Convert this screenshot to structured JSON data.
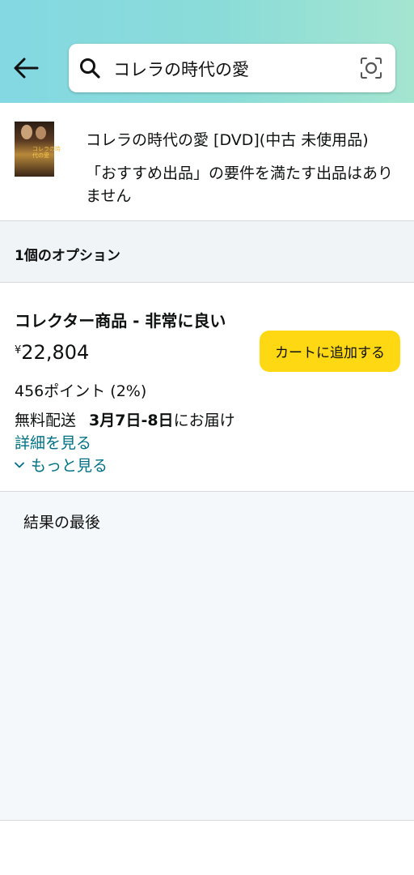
{
  "search": {
    "query": "コレラの時代の愛"
  },
  "product": {
    "title": "コレラの時代の愛 [DVD](中古 未使用品)",
    "note": "「おすすめ出品」の要件を満たす出品はありません",
    "thumbnail_text": "コレラの時代の愛"
  },
  "options": {
    "label": "1個のオプション"
  },
  "offer": {
    "condition": "コレクター商品 - 非常に良い",
    "currency": "¥",
    "price": "22,804",
    "cart_button": "カートに追加する",
    "points": "456ポイント (2%)",
    "delivery_prefix": "無料配送",
    "delivery_date": "3月7日-8日",
    "delivery_suffix": "にお届け",
    "details_link": "詳細を見る",
    "more_link": "もっと見る"
  },
  "footer": {
    "end_of_results": "結果の最後"
  },
  "colors": {
    "link": "#007185",
    "cart_button": "#ffd814",
    "header_gradient_start": "#83d8e2",
    "header_gradient_end": "#a4e5d0"
  },
  "icons": {
    "back": "arrow-left-icon",
    "search": "search-icon",
    "camera": "camera-lens-icon",
    "expand": "chevron-down-icon"
  }
}
